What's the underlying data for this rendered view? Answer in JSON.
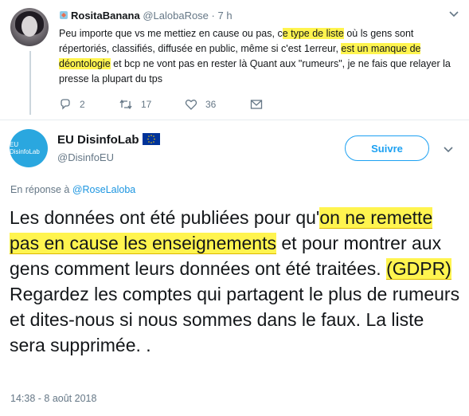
{
  "top_tweet": {
    "name": "RositaBanana",
    "handle": "@LalobaRose",
    "separator": "·",
    "time": "7 h",
    "text_parts": {
      "p1": "Peu importe que vs me mettiez en cause ou pas, c",
      "h1": "e type de liste",
      "p2": " où ls gens sont répertoriés, classifiés, diffusée en public, même si c'est 1erreur, ",
      "h2": "est un manque de déontologie",
      "p3": " et bcp ne vont pas en rester là Quant aux \"rumeurs\", je ne fais que relayer la presse la plupart du tps"
    },
    "actions": {
      "replies": "2",
      "retweets": "17",
      "likes": "36"
    }
  },
  "main_tweet": {
    "name": "EU DisinfoLab",
    "handle": "@DisinfoEU",
    "avatar_text": "EU DisinfoLab",
    "follow_label": "Suivre",
    "reply_prefix": "En réponse à ",
    "reply_to": "@RoseLaloba",
    "text_parts": {
      "p1": "Les données ont été publiées pour qu'",
      "h1": "on ne remette pas en cause les enseignements",
      "p2": " et pour montrer aux gens comment leurs données ont été traitées. ",
      "h2": "(GDPR)",
      "p3": " Regardez les comptes qui partagent le plus de rumeurs et dites-nous si nous sommes dans le faux. La liste sera supprimée. ."
    },
    "timestamp": "14:38 - 8 août 2018"
  },
  "colors": {
    "highlight": "#fff44f",
    "link": "#1da1f2",
    "muted": "#657786"
  }
}
